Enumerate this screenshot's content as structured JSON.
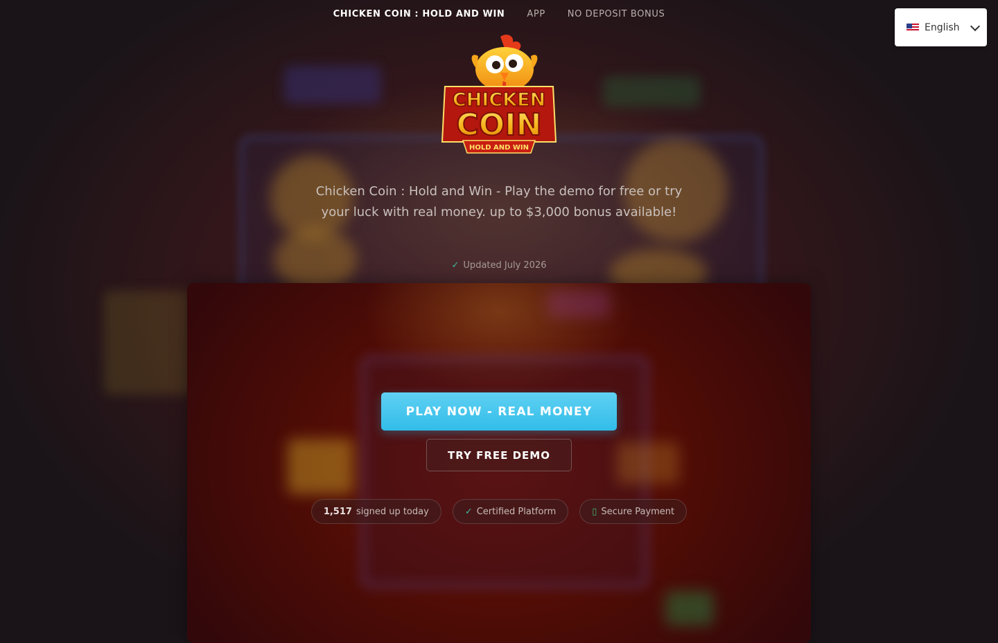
{
  "nav": {
    "brand": "CHICKEN COIN : HOLD AND WIN",
    "links": [
      "APP",
      "NO DEPOSIT BONUS"
    ]
  },
  "language": {
    "label": "English",
    "flag_icon": "us-flag-icon"
  },
  "logo": {
    "line1": "CHICKEN",
    "line2": "COIN",
    "ribbon": "HOLD AND WIN"
  },
  "hero": {
    "tagline": "Chicken Coin : Hold and Win - Play the demo for free or try your luck with real money. up to $3,000 bonus available!",
    "updated_check": "✓",
    "updated": "Updated July 2026"
  },
  "cta": {
    "primary": "PLAY NOW - REAL MONEY",
    "secondary": "TRY FREE DEMO"
  },
  "badges": {
    "signups_count": "1,517",
    "signups_text": "signed up today",
    "certified_icon": "✓",
    "certified": "Certified Platform",
    "secure_icon": "▯",
    "secure": "Secure Payment"
  },
  "colors": {
    "accent": "#32bde9",
    "check": "#3fb8a0",
    "logo_gold": "#f6b21a",
    "logo_red": "#c81f12"
  }
}
